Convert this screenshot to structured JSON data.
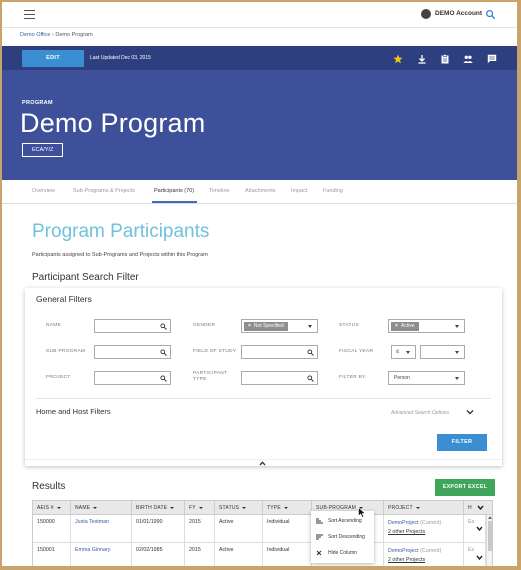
{
  "header": {
    "account_label": "DEMO Account"
  },
  "breadcrumb": {
    "parent": "Demo Office",
    "separator": "›",
    "current": "Demo Program"
  },
  "toolbar": {
    "edit_label": "EDIT",
    "last_updated": "Last Updated Dec 03, 2015"
  },
  "hero": {
    "kicker": "PROGRAM",
    "title": "Demo Program",
    "code": "ECA/Y/Z"
  },
  "tabs": [
    "Overview",
    "Sub-Programs & Projects",
    "Participants (70)",
    "Timeline",
    "Attachments",
    "Impact",
    "Funding"
  ],
  "active_tab": "Participants (70)",
  "page": {
    "title": "Program Participants",
    "description": "Participants assigned to Sub-Programs and Projects within this Program",
    "filter_title": "Participant Search Filter"
  },
  "filters": {
    "section_title": "General Filters",
    "name_label": "NAME",
    "gender_label": "GENDER",
    "gender_chip": "Not Specified",
    "status_label": "STATUS",
    "status_chip": "Active",
    "subprogram_label": "SUB PROGRAM",
    "field_label": "FIELD OF STUDY",
    "fiscal_label": "FISCAL YEAR",
    "fiscal_op": "≤",
    "project_label": "PROJECT",
    "ptype_label_1": "PARTICIPANT",
    "ptype_label_2": "TYPE",
    "filterby_label": "FILTER BY",
    "filterby_value": "Person",
    "home_host_title": "Home and Host Filters",
    "advanced_label": "Advanced Search Options",
    "filter_button": "FILTER"
  },
  "results": {
    "title": "Results",
    "export_label": "EXPORT EXCEL",
    "columns": [
      "AEIS #",
      "NAME",
      "BIRTH DATE",
      "FY",
      "STATUS",
      "TYPE",
      "SUB-PROGRAM",
      "PROJECT",
      "HO"
    ],
    "rows": [
      {
        "aeis": "150000",
        "name": "Justa Testman",
        "birth": "01/01/1990",
        "fy": "2015",
        "status": "Active",
        "type": "Individual",
        "project": "DemoProject",
        "project_tag": "(Current)",
        "other": "2 other Projects",
        "host": "Es"
      },
      {
        "aeis": "150001",
        "name": "Emma Ginnary",
        "birth": "02/02/1985",
        "fy": "2015",
        "status": "Active",
        "type": "Individual",
        "project": "DemoProject",
        "project_tag": "(Current)",
        "other": "2 other Projects",
        "host": "Es"
      }
    ]
  },
  "column_menu": {
    "items": [
      "Sort Ascending",
      "Sort Descending",
      "Hide Column"
    ]
  },
  "colors": {
    "navy": "#2e3f80",
    "hero": "#3e5099",
    "accent_blue": "#3b8ed2",
    "title_cyan": "#6fc2dd",
    "export_green": "#3fa65c"
  }
}
